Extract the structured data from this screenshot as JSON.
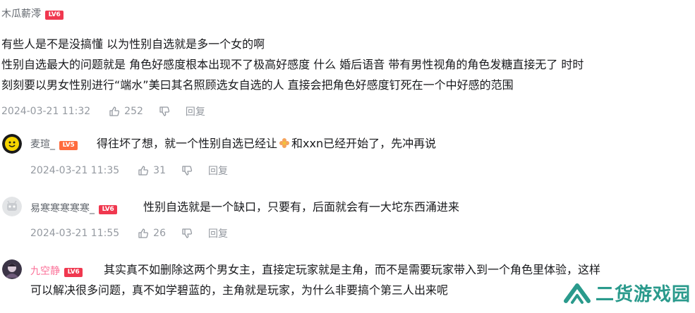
{
  "comments": [
    {
      "username": "木瓜薪澪",
      "level": "LV6",
      "lines": [
        "有些人是不是没搞懂 以为性别自选就是多一个女的啊",
        "性别自选最大的问题就是 角色好感度根本出现不了极高好感度 什么 婚后语音  带有男性视角的角色发糖直接无了 时时",
        "刻刻要以男女性别进行“端水”美曰其名照顾选女自选的人 直接会把角色好感度钉死在一个中好感的范围"
      ],
      "time": "2024-03-21 11:32",
      "likes": "252",
      "reply": "回复"
    },
    {
      "username": "麦瑄_",
      "level": "LV5",
      "content_before": "得往坏了想，就一个性别自选已经让",
      "content_after": "和xxn已经开始了，先冲再说",
      "emoji": "flower-emoji",
      "time": "2024-03-21 11:35",
      "likes": "31",
      "reply": "回复"
    },
    {
      "username": "易寒寒寒寒寒_",
      "level": "LV6",
      "content": "性别自选就是一个缺口，只要有，后面就会有一大坨东西涌进来",
      "time": "2024-03-21 11:55",
      "likes": "26",
      "reply": "回复"
    },
    {
      "username": "九空静",
      "level": "LV6",
      "lines": [
        "其实真不如删除这两个男女主，直接定玩家就是主角，而不是需要玩家带入到一个角色里体验，这样",
        "可以解决很多问题，真不如学碧蓝的，主角就是玩家，为什么非要搞个第三人出来呢"
      ]
    }
  ],
  "watermark": {
    "text": "二货游戏园",
    "color": "#2a9a8c"
  },
  "colors": {
    "meta": "#9499a0",
    "text": "#18191c",
    "vip_name": "#fb7299",
    "level_badge": "#f0384f"
  },
  "icons": [
    "thumbs-up-icon",
    "thumbs-down-icon",
    "lv-badge"
  ]
}
